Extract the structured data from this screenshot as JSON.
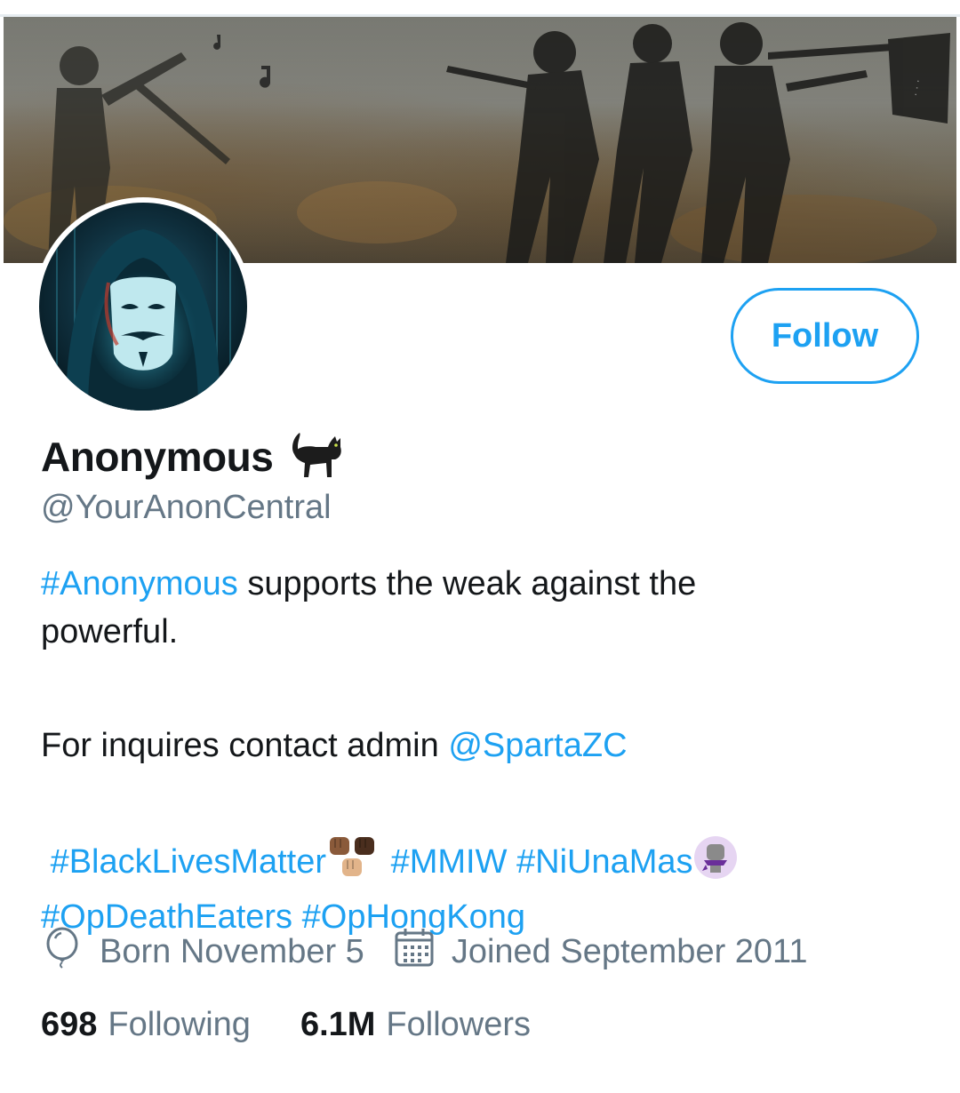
{
  "profile": {
    "display_name": "Anonymous",
    "handle": "@YourAnonCentral",
    "follow_label": "Follow",
    "name_emoji": "black-cat-icon"
  },
  "bio": {
    "line1_hashtag": "#Anonymous",
    "line1_text": " supports the weak against the",
    "line2_text": "powerful.",
    "contact_text": "For inquires contact admin ",
    "contact_mention": "@SpartaZC",
    "tags": [
      "#BlackLivesMatter",
      "#MMIW",
      "#NiUnaMas",
      "#OpDeathEaters",
      "#OpHongKong"
    ]
  },
  "meta": {
    "birthday": "Born November 5",
    "joined": "Joined September 2011",
    "birthday_icon": "balloon-icon",
    "joined_icon": "calendar-icon"
  },
  "stats": {
    "following_count": "698",
    "following_label": "Following",
    "followers_count": "6.1M",
    "followers_label": "Followers"
  },
  "colors": {
    "accent": "#1da1f2",
    "text": "#14171a",
    "muted": "#657786"
  }
}
